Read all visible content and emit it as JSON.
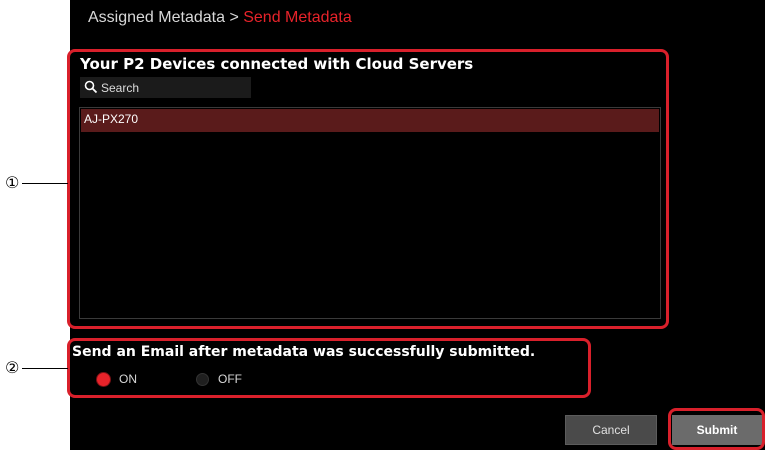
{
  "breadcrumb": {
    "parent": "Assigned Metadata",
    "separator": ">",
    "current": "Send Metadata"
  },
  "devices": {
    "title": "Your P2 Devices connected with Cloud Servers",
    "search_placeholder": "Search",
    "items": [
      {
        "name": "AJ-PX270",
        "selected": true
      }
    ]
  },
  "email": {
    "title": "Send an Email after metadata was successfully submitted.",
    "options": [
      {
        "label": "ON",
        "selected": true
      },
      {
        "label": "OFF",
        "selected": false
      }
    ]
  },
  "buttons": {
    "cancel": "Cancel",
    "submit": "Submit"
  },
  "callouts": [
    "①",
    "②"
  ],
  "colors": {
    "accent_red": "#e8232a",
    "highlight_border": "#d9202b",
    "selected_row": "#5a1b1b",
    "panel_bg": "#000000"
  }
}
